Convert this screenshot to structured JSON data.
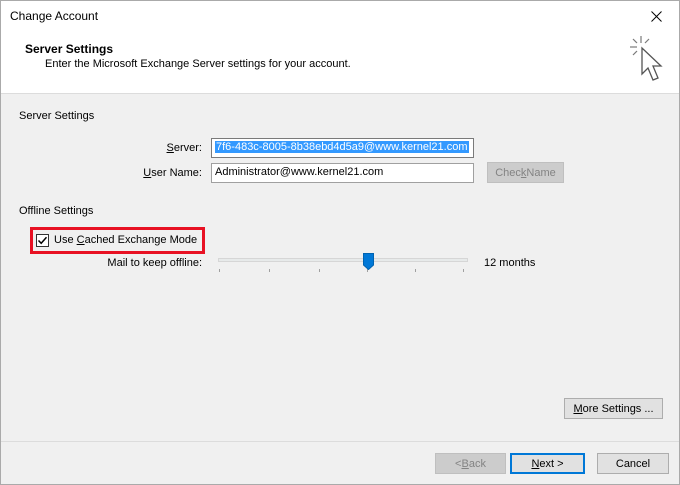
{
  "window": {
    "title": "Change Account"
  },
  "header": {
    "title": "Server Settings",
    "subtitle": "Enter the Microsoft Exchange Server settings for your account."
  },
  "server_settings": {
    "section_label": "Server Settings",
    "server": {
      "label_pre": "",
      "label_accel": "S",
      "label_post": "erver:",
      "value": "7f6-483c-8005-8b38ebd4d5a9@www.kernel21.com"
    },
    "user_name": {
      "label_pre": "",
      "label_accel": "U",
      "label_post": "ser Name:",
      "value": "Administrator@www.kernel21.com"
    },
    "check_name": {
      "label_pre": "Chec",
      "label_accel": "k",
      "label_post": " Name"
    }
  },
  "offline_settings": {
    "section_label": "Offline Settings",
    "cached_mode": {
      "label_pre": "Use ",
      "label_accel": "C",
      "label_post": "ached Exchange Mode",
      "checked": true
    },
    "mail_to_keep_label": "Mail to keep offline:",
    "months_text": "12 months",
    "slider_position": 0.6
  },
  "buttons": {
    "more_settings": {
      "label_pre": "",
      "label_accel": "M",
      "label_post": "ore Settings ..."
    },
    "back": {
      "label_pre": "< ",
      "label_accel": "B",
      "label_post": "ack"
    },
    "next": {
      "label_pre": "",
      "label_accel": "N",
      "label_post": "ext >"
    },
    "cancel": "Cancel"
  },
  "colors": {
    "accent": "#0078d7",
    "highlight_frame": "#e81123",
    "selection": "#3399ff"
  }
}
